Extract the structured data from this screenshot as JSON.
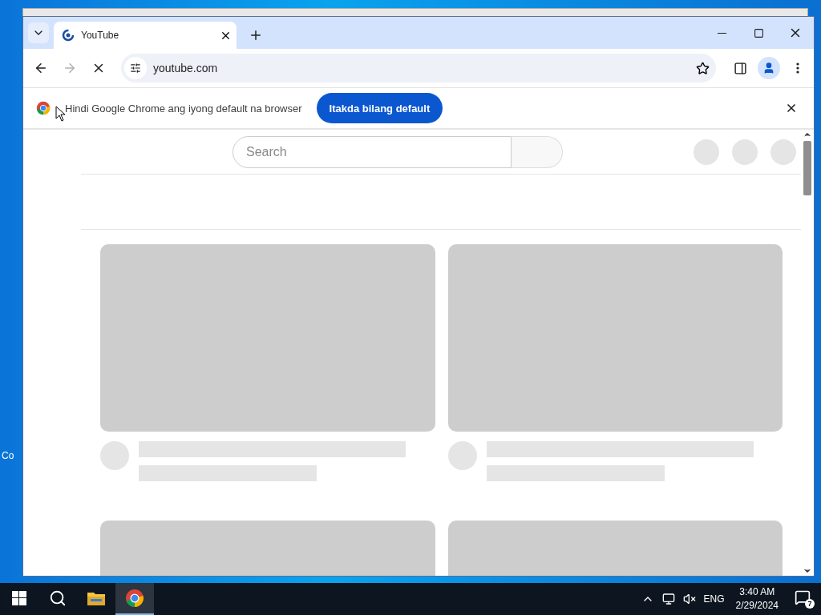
{
  "desktop": {
    "icon_label": "Co"
  },
  "browser": {
    "tabs": [
      {
        "title": "YouTube",
        "selected": true
      }
    ],
    "toolbar": {
      "url": "youtube.com",
      "loading": true,
      "forward_enabled": false
    },
    "infobar": {
      "message": "Hindi Google Chrome ang iyong default na browser",
      "button": "Itakda bilang default"
    },
    "page": {
      "search": {
        "placeholder": "Search"
      }
    }
  },
  "taskbar": {
    "apps": [
      {
        "kind": "search",
        "selected": false
      },
      {
        "kind": "files",
        "selected": false
      },
      {
        "kind": "chrome",
        "selected": true
      }
    ],
    "language": "ENG",
    "time": "3:40 AM",
    "date": "2/29/2024",
    "notifications": "7"
  }
}
